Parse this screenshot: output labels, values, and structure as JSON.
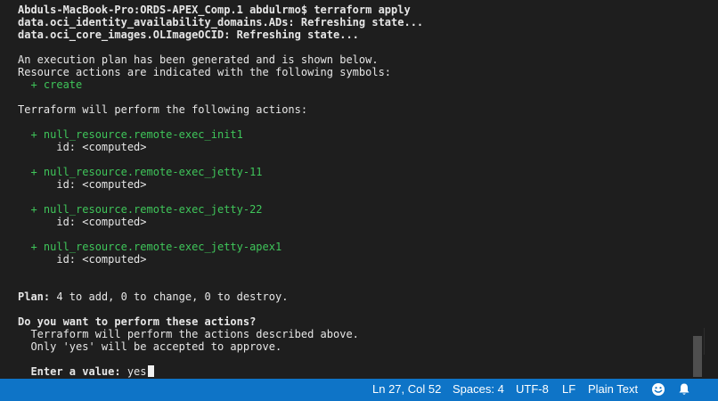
{
  "terminal": {
    "lines": [
      {
        "text": "Abduls-MacBook-Pro:ORDS-APEX_Comp.1 abdulrmo$ terraform apply",
        "style": "normal"
      },
      {
        "text": "data.oci_identity_availability_domains.ADs: Refreshing state...",
        "style": "bold"
      },
      {
        "text": "data.oci_core_images.OLImageOCID: Refreshing state...",
        "style": "bold"
      },
      {
        "text": "",
        "style": "normal"
      },
      {
        "text": "An execution plan has been generated and is shown below.",
        "style": "normal"
      },
      {
        "text": "Resource actions are indicated with the following symbols:",
        "style": "normal"
      },
      {
        "text": "  + create",
        "style": "green"
      },
      {
        "text": "",
        "style": "normal"
      },
      {
        "text": "Terraform will perform the following actions:",
        "style": "normal"
      },
      {
        "text": "",
        "style": "normal"
      },
      {
        "text": "  + null_resource.remote-exec_init1",
        "style": "green"
      },
      {
        "text": "      id: <computed>",
        "style": "normal"
      },
      {
        "text": "",
        "style": "normal"
      },
      {
        "text": "  + null_resource.remote-exec_jetty-11",
        "style": "green"
      },
      {
        "text": "      id: <computed>",
        "style": "normal"
      },
      {
        "text": "",
        "style": "normal"
      },
      {
        "text": "  + null_resource.remote-exec_jetty-22",
        "style": "green"
      },
      {
        "text": "      id: <computed>",
        "style": "normal"
      },
      {
        "text": "",
        "style": "normal"
      },
      {
        "text": "  + null_resource.remote-exec_jetty-apex1",
        "style": "green"
      },
      {
        "text": "      id: <computed>",
        "style": "normal"
      },
      {
        "text": "",
        "style": "normal"
      },
      {
        "text": "",
        "style": "normal"
      },
      {
        "text": "Plan:",
        "style": "bold",
        "rest": " 4 to add, 0 to change, 0 to destroy."
      },
      {
        "text": "",
        "style": "normal"
      },
      {
        "text": "Do you want to perform these actions?",
        "style": "bold"
      },
      {
        "text": "  Terraform will perform the actions described above.",
        "style": "normal"
      },
      {
        "text": "  Only 'yes' will be accepted to approve.",
        "style": "normal"
      },
      {
        "text": "",
        "style": "normal"
      },
      {
        "text": "  Enter a value:",
        "style": "bold",
        "rest": " yes",
        "cursor": true
      }
    ]
  },
  "statusbar": {
    "position": "Ln 27, Col 52",
    "spaces": "Spaces: 4",
    "encoding": "UTF-8",
    "eol": "LF",
    "language": "Plain Text",
    "feedback_icon": "smiley-face-icon",
    "notifications_icon": "bell-icon"
  },
  "colors": {
    "background": "#1e1e1e",
    "text": "#e6e6e6",
    "green": "#3fc55a",
    "statusbar": "#0e74c7"
  }
}
